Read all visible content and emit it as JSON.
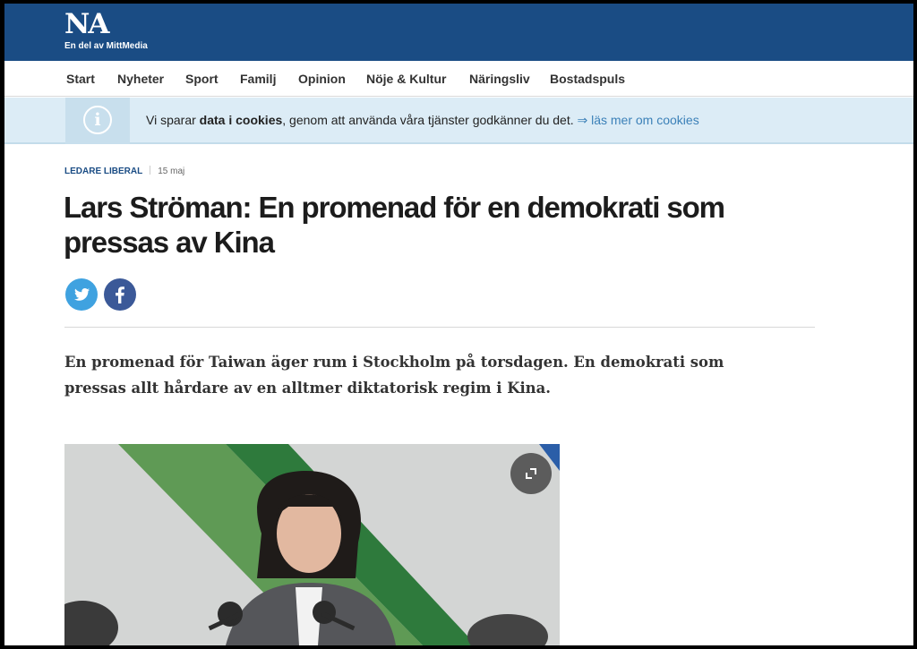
{
  "header": {
    "logo": "NA",
    "tagline": "En del av MittMedia"
  },
  "nav": {
    "items": [
      "Start",
      "Nyheter",
      "Sport",
      "Familj",
      "Opinion",
      "Nöje & Kultur",
      "Näringsliv",
      "Bostadspuls"
    ]
  },
  "cookie_notice": {
    "text_before": "Vi sparar ",
    "text_bold": "data i cookies",
    "text_after": ", genom att använda våra tjänster godkänner du det. ",
    "link_text": "⇒ läs mer om cookies",
    "icon": "info-icon"
  },
  "article": {
    "category": "Ledare Liberal",
    "date": "15 maj",
    "headline": "Lars Ströman: En promenad för en demokrati som pressas av Kina",
    "lead": "En promenad för Taiwan äger rum i Stockholm på torsdagen. En demokrati som pressas allt hårdare av en alltmer diktatorisk regim i Kina.",
    "share": {
      "twitter_icon": "twitter-icon",
      "facebook_icon": "facebook-icon"
    },
    "image": {
      "expand_icon": "expand-icon"
    }
  },
  "colors": {
    "brand": "#1a4c84",
    "cookie_bg": "#dcecf6",
    "link": "#3b80b8",
    "twitter": "#3fa2e0",
    "facebook": "#3b5998"
  }
}
